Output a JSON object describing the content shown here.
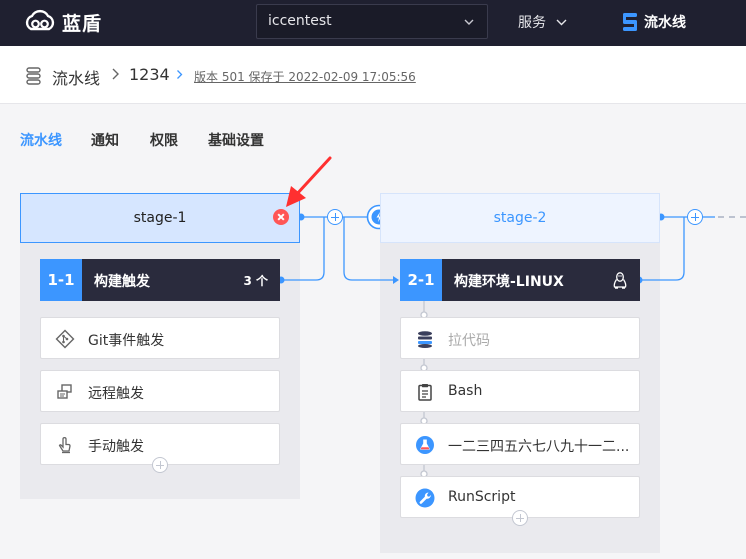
{
  "app": {
    "name": "蓝盾",
    "project": "iccentest",
    "service_menu": "服务",
    "current_service": "流水线"
  },
  "breadcrumb": {
    "items": [
      "流水线",
      "1234"
    ],
    "version_info": "版本 501 保存于 2022-02-09 17:05:56"
  },
  "tabs": [
    {
      "label": "流水线",
      "active": true
    },
    {
      "label": "通知",
      "active": false
    },
    {
      "label": "权限",
      "active": false
    },
    {
      "label": "基础设置",
      "active": false
    }
  ],
  "stages": [
    {
      "name": "stage-1",
      "job": {
        "index": "1-1",
        "name": "构建触发",
        "count": "3 个"
      },
      "tasks": [
        {
          "label": "Git事件触发",
          "icon": "git-icon"
        },
        {
          "label": "远程触发",
          "icon": "remote-icon"
        },
        {
          "label": "手动触发",
          "icon": "hand-icon"
        }
      ]
    },
    {
      "name": "stage-2",
      "job": {
        "index": "2-1",
        "name": "构建环境-LINUX",
        "os_icon": "linux-icon"
      },
      "tasks": [
        {
          "label": "拉代码",
          "icon": "checkout-icon",
          "dim": true
        },
        {
          "label": "Bash",
          "icon": "clipboard-icon"
        },
        {
          "label": "一二三四五六七八九十一二...",
          "icon": "flask-icon"
        },
        {
          "label": "RunScript",
          "icon": "wrench-icon"
        }
      ]
    }
  ],
  "colors": {
    "accent": "#3c96ff",
    "topbar": "#1f2030",
    "job_header": "#2a2b3d",
    "delete": "#ff5656",
    "arrow": "#ff3030"
  }
}
